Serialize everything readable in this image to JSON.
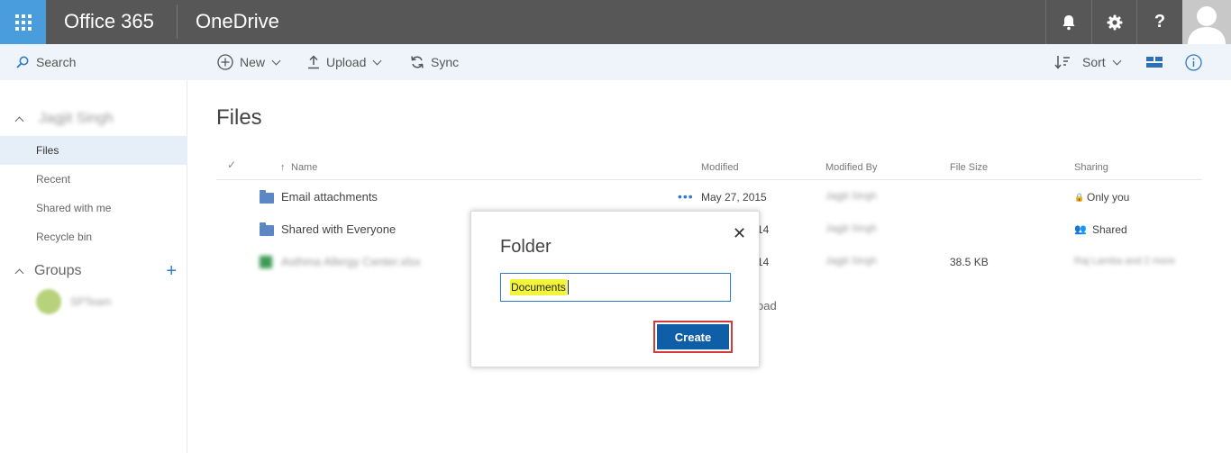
{
  "suite": {
    "brand": "Office 365",
    "app": "OneDrive"
  },
  "colors": {
    "suite_bar": "#575757",
    "waffle": "#4a9ddd",
    "accent": "#0f5ea8",
    "highlight": "#f3f53b",
    "outline": "#d33b3b"
  },
  "commandbar": {
    "search_label": "Search",
    "new_label": "New",
    "upload_label": "Upload",
    "sync_label": "Sync",
    "sort_label": "Sort"
  },
  "leftnav": {
    "user_name": "Jagjit Singh",
    "items": [
      {
        "label": "Files",
        "active": true
      },
      {
        "label": "Recent",
        "active": false
      },
      {
        "label": "Shared with me",
        "active": false
      },
      {
        "label": "Recycle bin",
        "active": false
      }
    ],
    "groups_label": "Groups",
    "group_name": "SPTeam"
  },
  "main": {
    "title": "Files",
    "columns": {
      "name": "Name",
      "modified": "Modified",
      "modified_by": "Modified By",
      "file_size": "File Size",
      "sharing": "Sharing"
    },
    "rows": [
      {
        "name": "Email attachments",
        "modified": "May 27, 2015",
        "modified_by": "Jagjit Singh",
        "file_size": "",
        "sharing": "Only you"
      },
      {
        "name": "Shared with Everyone",
        "modified": "14",
        "modified_by": "Jagjit Singh",
        "file_size": "",
        "sharing": "Shared"
      },
      {
        "name": "Asthma Allergy Center.xlsx",
        "modified": "14",
        "modified_by": "Jagjit Singh",
        "file_size": "38.5 KB",
        "sharing": "Raj Lamba and 2 more"
      }
    ],
    "peek_text": "oad"
  },
  "dialog": {
    "title": "Folder",
    "input_value": "Documents",
    "create_label": "Create"
  }
}
